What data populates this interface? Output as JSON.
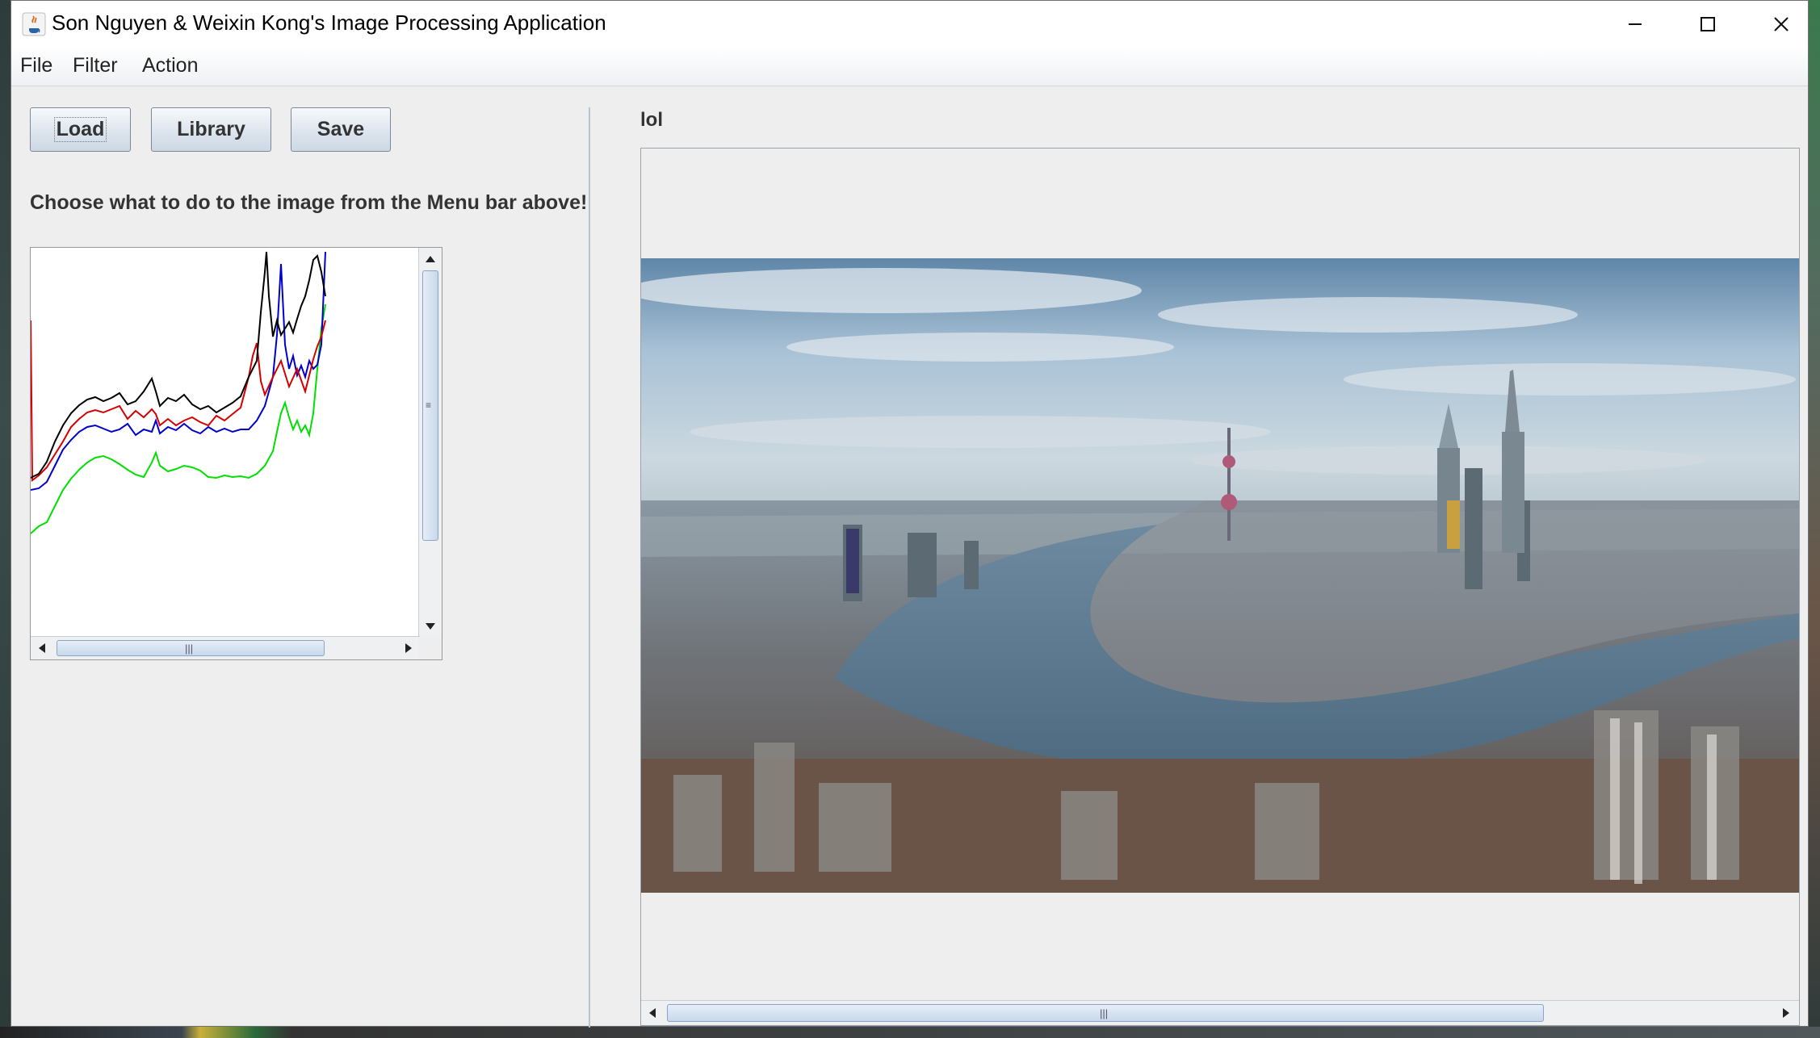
{
  "window": {
    "title": "Son Nguyen & Weixin Kong's Image Processing Application",
    "controls": [
      "minimize-icon",
      "maximize-icon",
      "close-icon"
    ]
  },
  "menu": {
    "items": [
      {
        "label": "File"
      },
      {
        "label": "Filter"
      },
      {
        "label": "Action"
      }
    ]
  },
  "toolbar": {
    "load_label": "Load",
    "library_label": "Library",
    "save_label": "Save"
  },
  "instruction": "Choose what to do to the image from the Menu bar above!",
  "histogram": {
    "series_colors": {
      "red": "#d40000",
      "green": "#00e000",
      "blue": "#0000cc",
      "luminance": "#000000"
    },
    "vertical_scroll_position": 0.0,
    "horizontal_scroll_position": 0.0
  },
  "image_view": {
    "image_name": "lol",
    "horizontal_scroll_position": 0.0
  },
  "colors": {
    "window_bg": "#eeeeee",
    "button_gradient_bottom": "#cdd8e4",
    "scroll_thumb": "#c8d8ec"
  }
}
